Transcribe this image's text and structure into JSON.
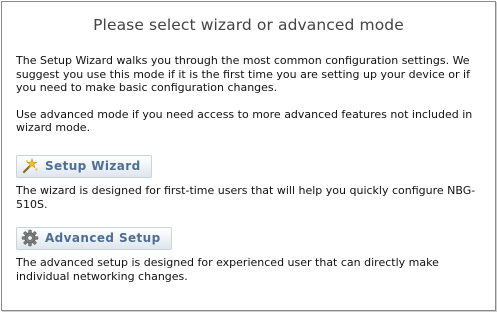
{
  "title": "Please select wizard or advanced mode",
  "intro": {
    "paragraph1": "The Setup Wizard walks you through the most common configuration settings. We suggest you use this mode if it is the first time you are setting up your device or if you need to make basic configuration changes.",
    "paragraph2": "Use advanced mode if you need access to more advanced features not included in wizard mode."
  },
  "wizard": {
    "button_label": "Setup Wizard",
    "icon": "wizard-wand-icon",
    "description": "The wizard is designed for first-time users that will help you quickly configure NBG-510S."
  },
  "advanced": {
    "button_label": "Advanced Setup",
    "icon": "gear-icon",
    "description": "The advanced setup is designed for experienced user that can directly make individual networking changes."
  }
}
